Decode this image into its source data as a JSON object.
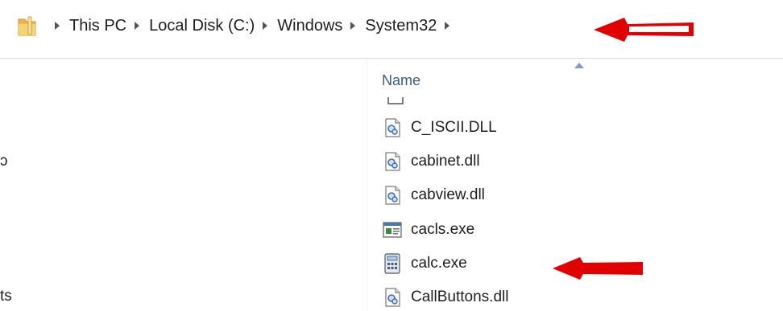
{
  "address_bar": {
    "icon": "folder-icon",
    "breadcrumbs": [
      "This PC",
      "Local Disk (C:)",
      "Windows",
      "System32"
    ]
  },
  "navigation_pane": {
    "fragments": [
      "ɔ",
      "ts"
    ]
  },
  "file_list": {
    "column_header": "Name",
    "sort": "ascending",
    "files": [
      {
        "name": "C_ISCII.DLL",
        "icon": "dll-icon"
      },
      {
        "name": "cabinet.dll",
        "icon": "dll-icon"
      },
      {
        "name": "cabview.dll",
        "icon": "dll-icon"
      },
      {
        "name": "cacls.exe",
        "icon": "exe-window-icon"
      },
      {
        "name": "calc.exe",
        "icon": "calculator-icon"
      },
      {
        "name": "CallButtons.dll",
        "icon": "dll-icon"
      }
    ]
  },
  "annotation": {
    "color": "#e10000"
  }
}
